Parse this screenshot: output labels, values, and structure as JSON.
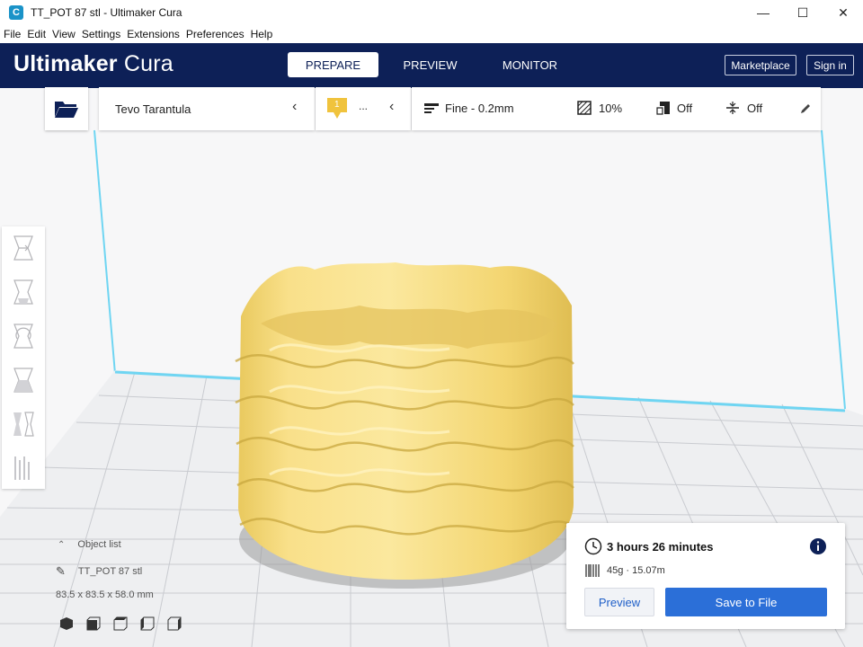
{
  "window": {
    "title": "TT_POT 87 stl - Ultimaker Cura",
    "app_icon_letter": "C",
    "minimize": "—",
    "maximize": "☐",
    "close": "✕"
  },
  "menu": [
    {
      "label": "File"
    },
    {
      "label": "Edit"
    },
    {
      "label": "View"
    },
    {
      "label": "Settings"
    },
    {
      "label": "Extensions"
    },
    {
      "label": "Preferences"
    },
    {
      "label": "Help"
    }
  ],
  "header": {
    "brand_bold": "Ultimaker",
    "brand_light": " Cura",
    "tabs": [
      {
        "label": "PREPARE",
        "active": true
      },
      {
        "label": "PREVIEW",
        "active": false
      },
      {
        "label": "MONITOR",
        "active": false
      }
    ],
    "marketplace": "Marketplace",
    "signin": "Sign in",
    "colors": {
      "header_bg": "#0d2057",
      "accent": "#2b6fd8",
      "model": "#f8dd7c"
    }
  },
  "topbar": {
    "printer": "Tevo Tarantula",
    "extruder_number": "1",
    "extruder_material": "...",
    "profile": "Fine - 0.2mm",
    "infill": "10%",
    "support": "Off",
    "adhesion": "Off"
  },
  "tools": [
    {
      "name": "move-tool-icon"
    },
    {
      "name": "scale-tool-icon"
    },
    {
      "name": "rotate-tool-icon"
    },
    {
      "name": "mirror-tool-icon"
    },
    {
      "name": "per-model-settings-icon"
    },
    {
      "name": "support-blocker-icon"
    }
  ],
  "object_list": {
    "header": "Object list",
    "object_name": "TT_POT 87 stl",
    "dimensions": "83.5 x 83.5 x 58.0 mm"
  },
  "action_panel": {
    "time": "3 hours 26 minutes",
    "material": "45g · 15.07m",
    "preview_label": "Preview",
    "save_label": "Save to File"
  }
}
